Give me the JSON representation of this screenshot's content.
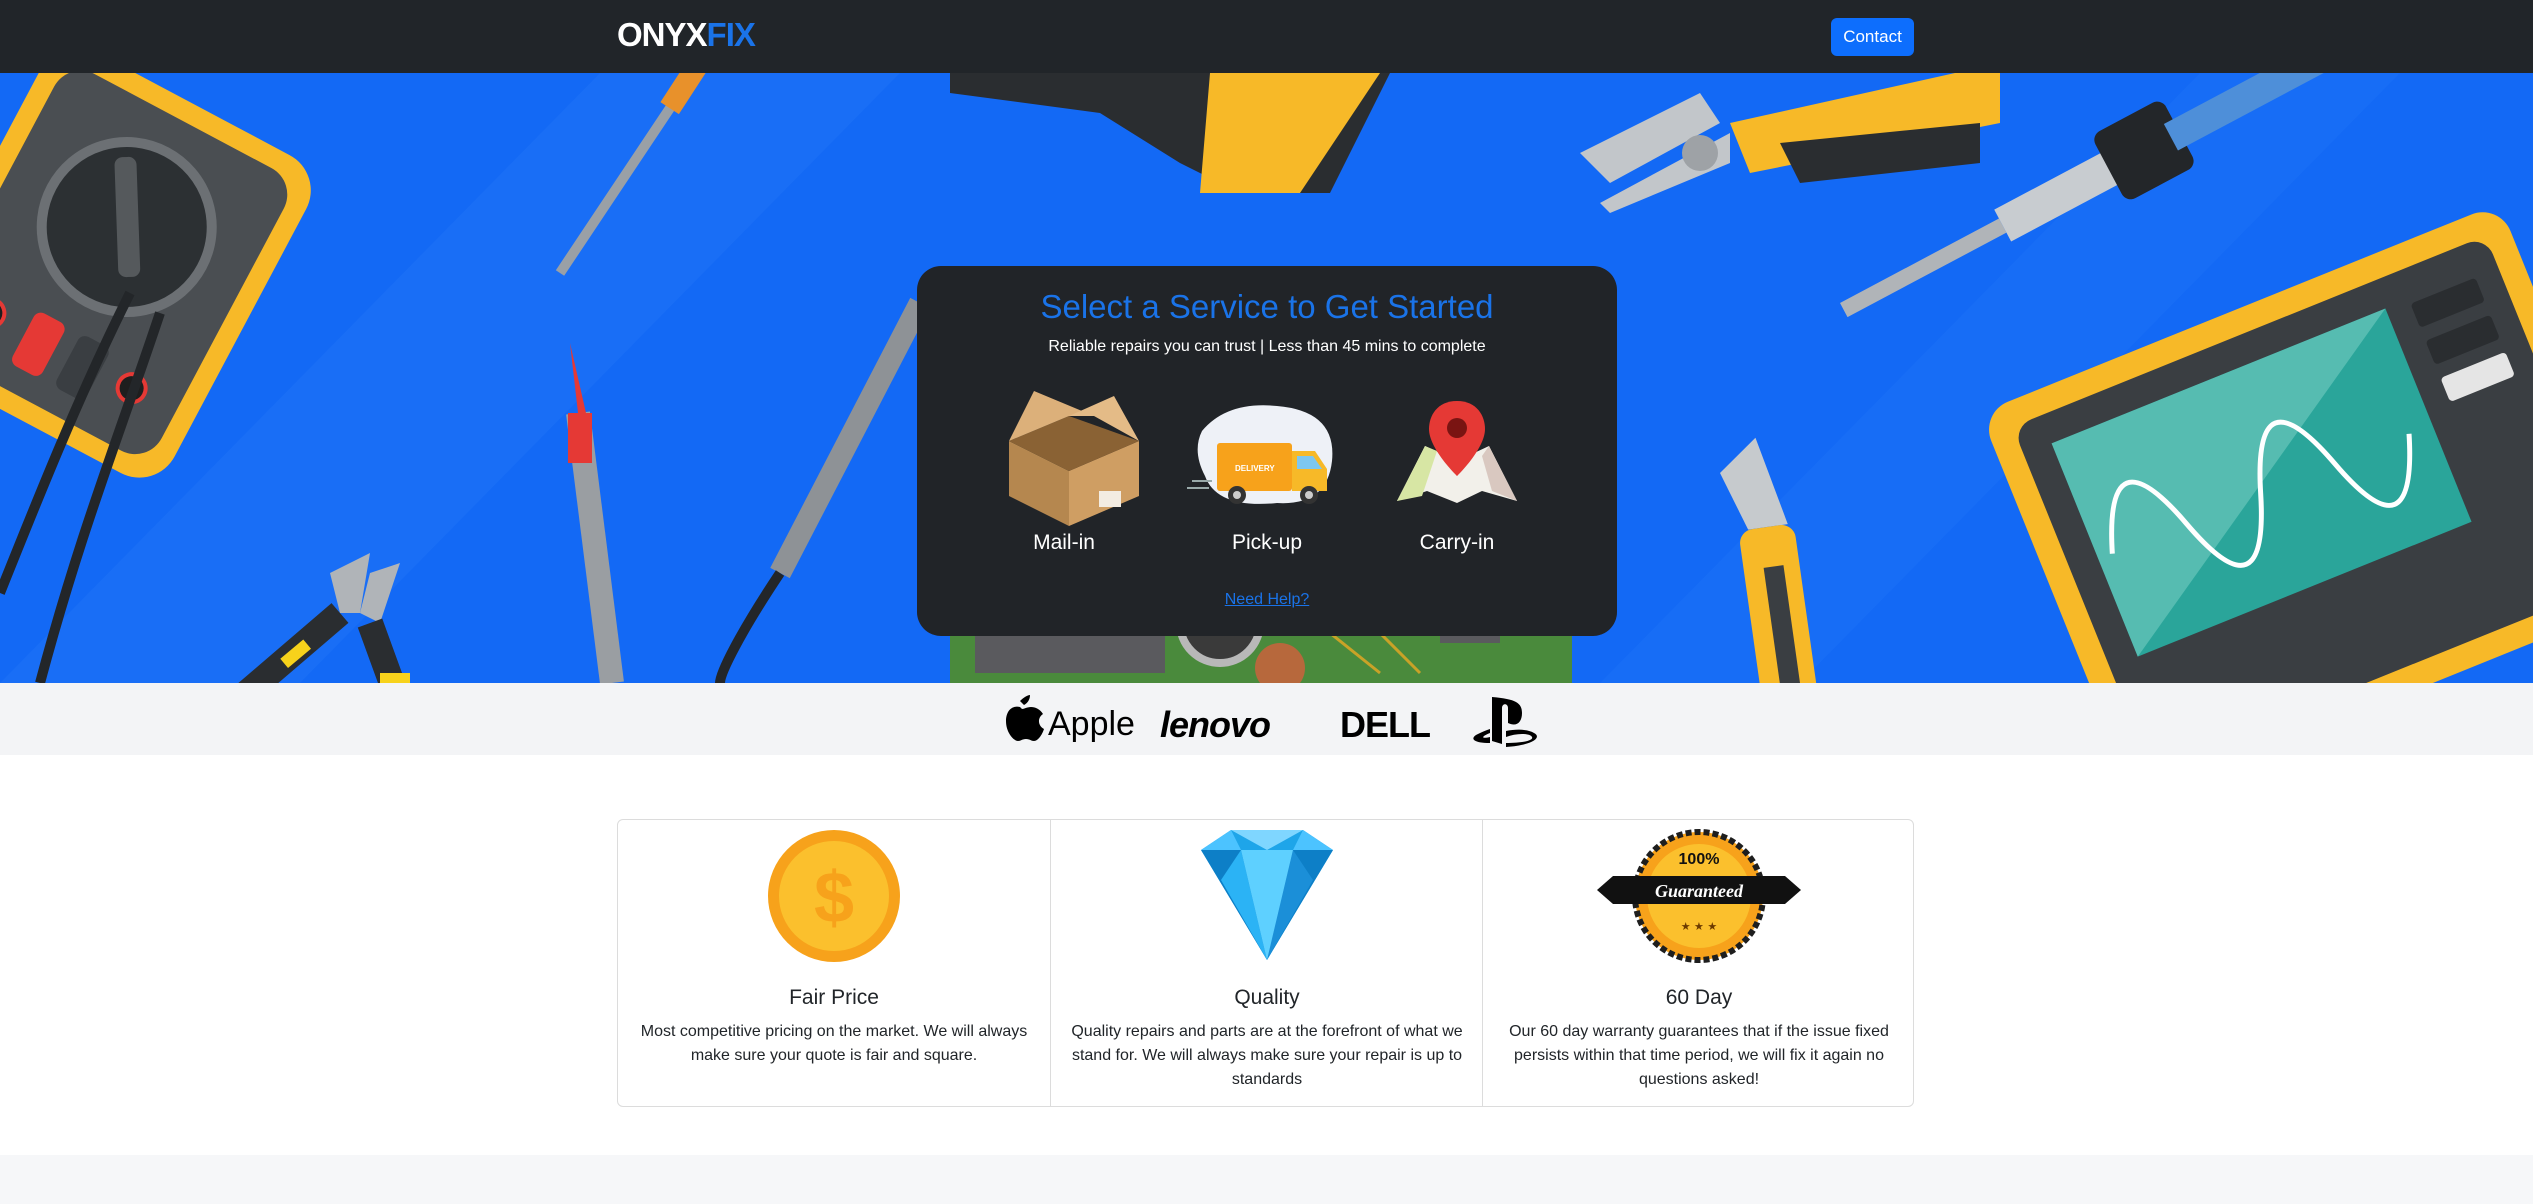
{
  "nav": {
    "brand_onyx": "ONYX",
    "brand_fix": "FIX",
    "contact_label": "Contact"
  },
  "hero": {
    "title": "Select a Service to Get Started",
    "subtitle": "Reliable repairs you can trust | Less than 45 mins to complete",
    "services": [
      {
        "label": "Mail-in",
        "icon": "box-icon"
      },
      {
        "label": "Pick-up",
        "icon": "delivery-truck-icon"
      },
      {
        "label": "Carry-in",
        "icon": "map-pin-icon"
      }
    ],
    "truck_text": "DELIVERY",
    "help_link": "Need Help?"
  },
  "brands": {
    "apple": "Apple",
    "lenovo": "lenovo",
    "dell": "DELL",
    "playstation": "playstation-logo"
  },
  "features": [
    {
      "title": "Fair Price",
      "text": "Most competitive pricing on the market. We will always make sure your quote is fair and square.",
      "icon": "coin-icon"
    },
    {
      "title": "Quality",
      "text": "Quality repairs and parts are at the forefront of what we stand for. We will always make sure your repair is up to standards",
      "icon": "diamond-icon"
    },
    {
      "title": "60 Day",
      "text": "Our 60 day warranty guarantees that if the issue fixed persists within that time period, we will fix it again no questions asked!",
      "icon": "guarantee-badge-icon"
    }
  ],
  "badge": {
    "top": "100%",
    "ribbon": "Guaranteed",
    "stars": "★ ★ ★"
  },
  "colors": {
    "accent": "#1a73e8",
    "nav_bg": "#212529",
    "hero_bg": "#1369f5",
    "button": "#0d6efd"
  }
}
